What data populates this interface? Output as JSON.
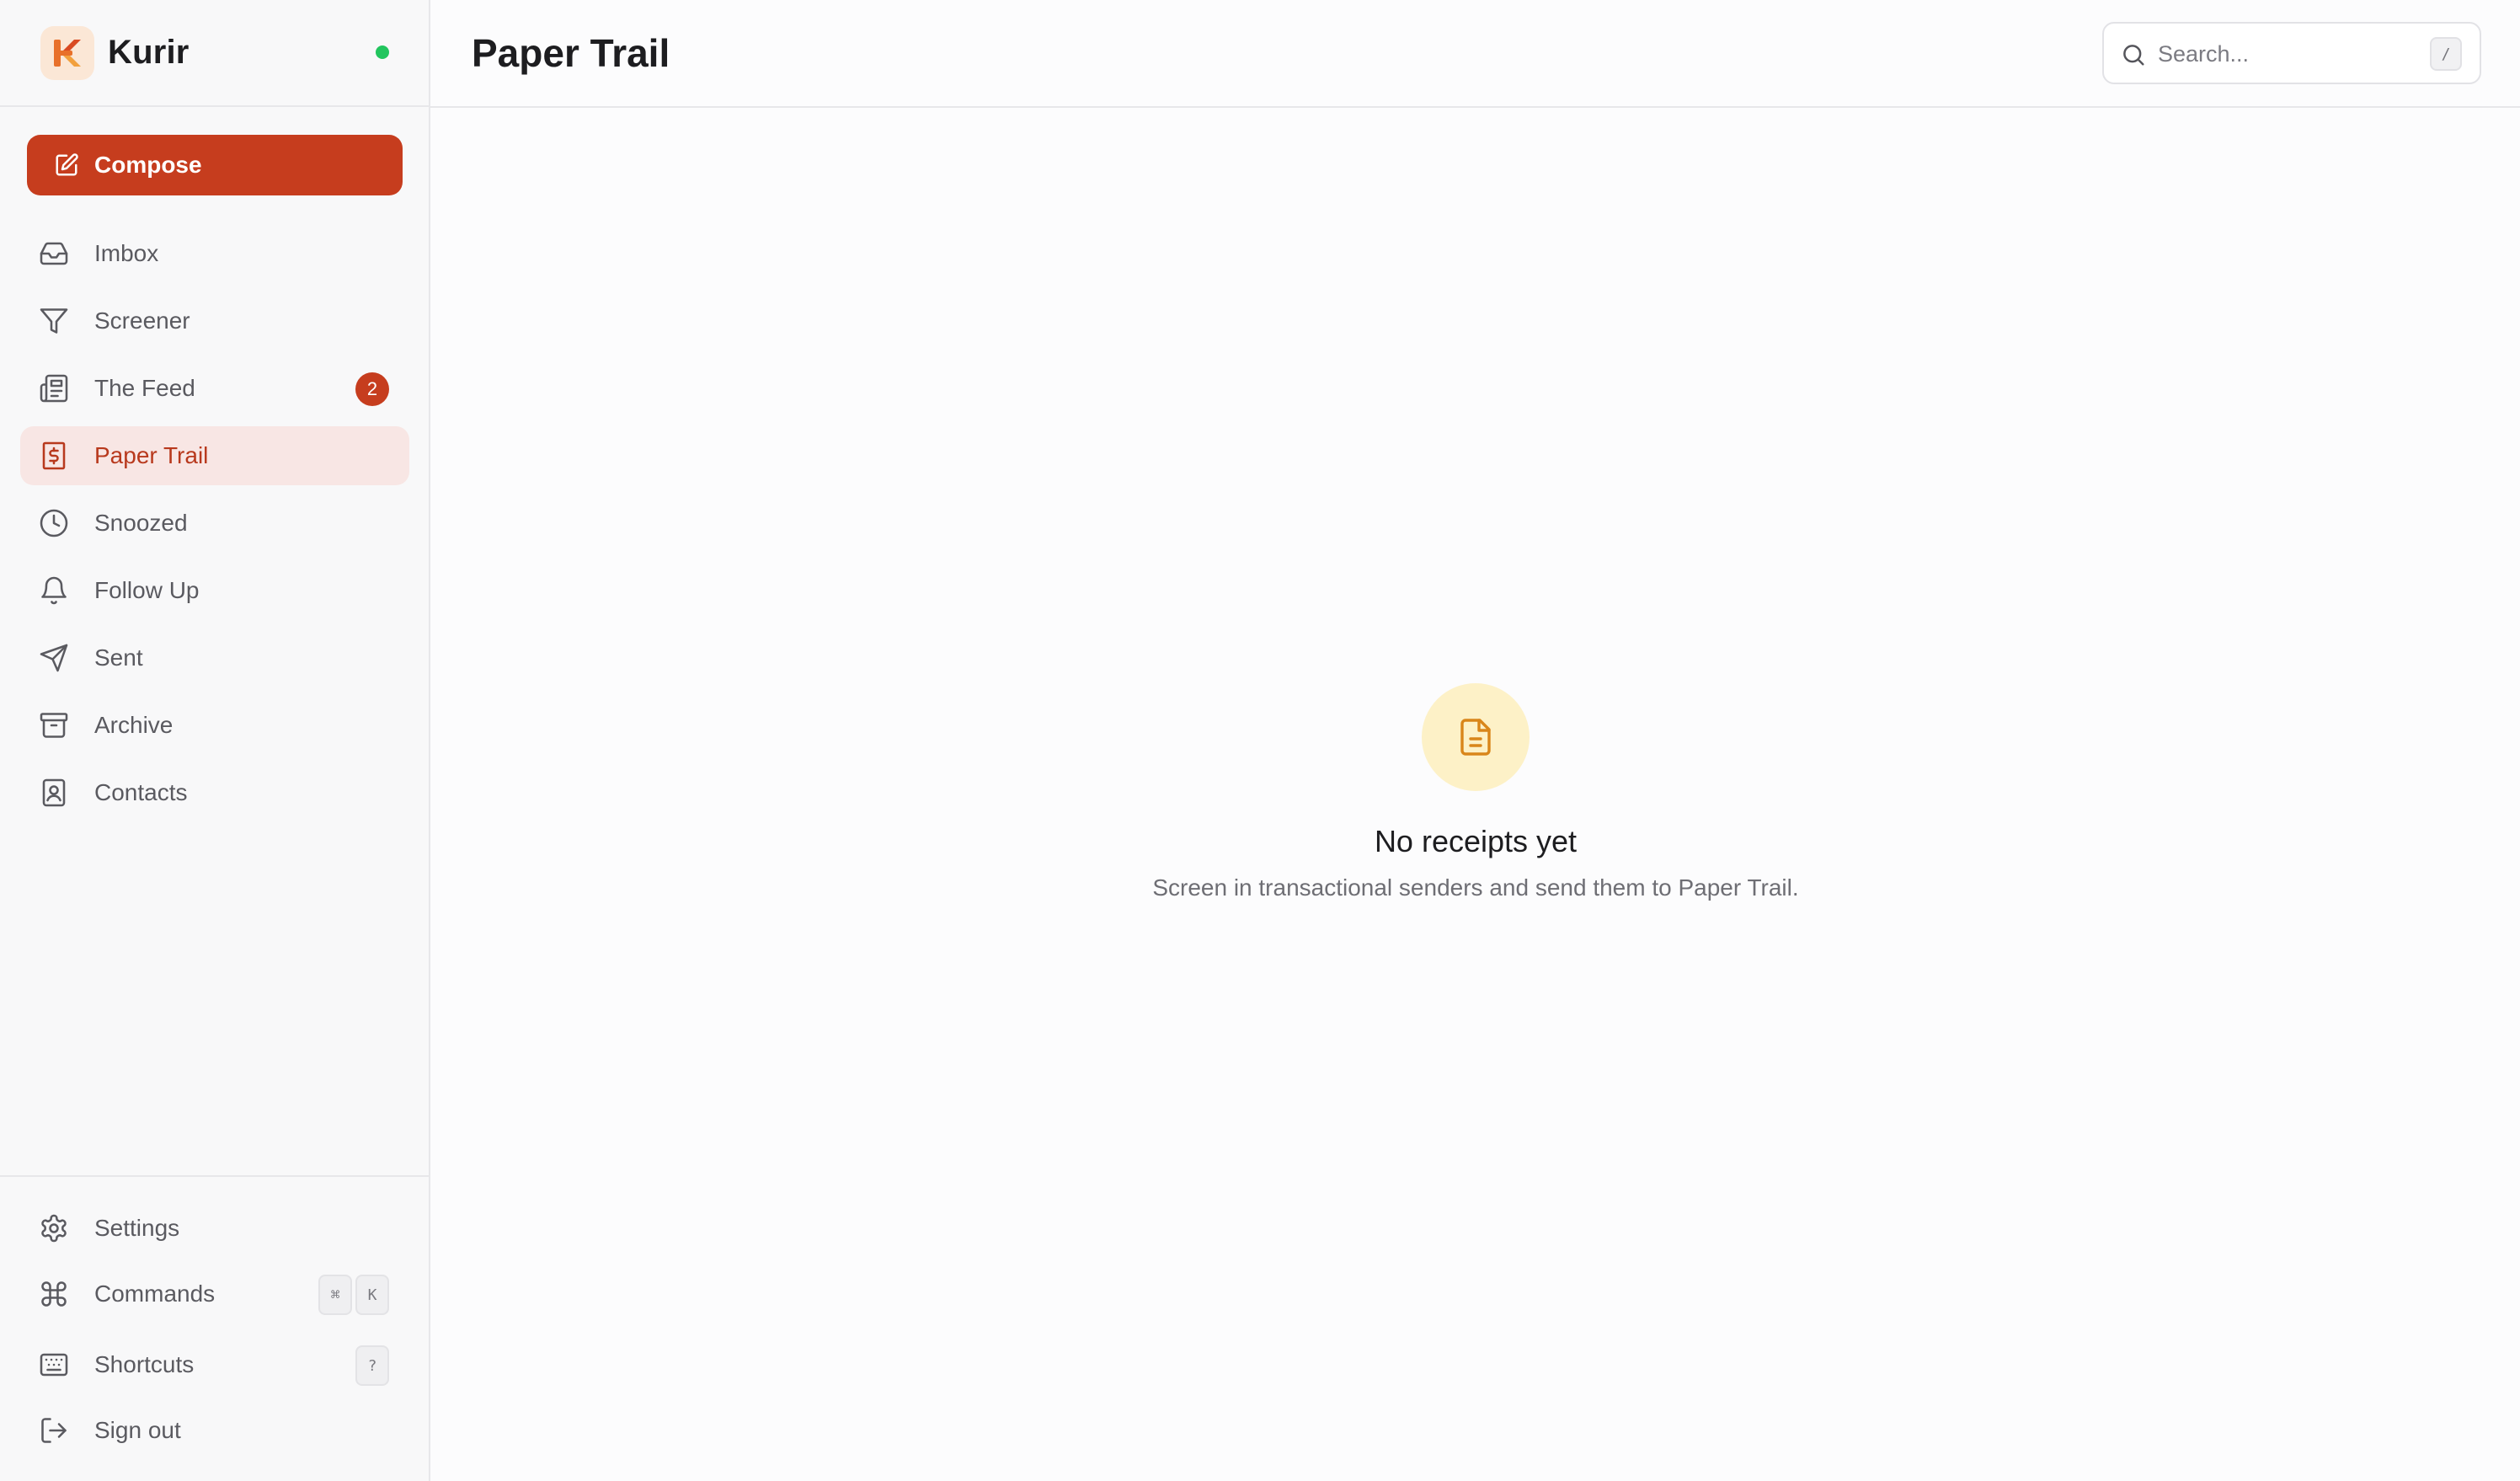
{
  "app": {
    "name": "Kurir",
    "status_color": "#22c55e",
    "accent_color": "#c63d1e"
  },
  "sidebar": {
    "compose_label": "Compose",
    "items": [
      {
        "label": "Imbox",
        "icon": "inbox-icon"
      },
      {
        "label": "Screener",
        "icon": "filter-icon"
      },
      {
        "label": "The Feed",
        "icon": "newspaper-icon",
        "badge": "2"
      },
      {
        "label": "Paper Trail",
        "icon": "receipt-icon",
        "active": true
      },
      {
        "label": "Snoozed",
        "icon": "clock-icon"
      },
      {
        "label": "Follow Up",
        "icon": "bell-icon"
      },
      {
        "label": "Sent",
        "icon": "send-icon"
      },
      {
        "label": "Archive",
        "icon": "archive-icon"
      },
      {
        "label": "Contacts",
        "icon": "contact-book-icon"
      }
    ],
    "footer": [
      {
        "label": "Settings",
        "icon": "gear-icon"
      },
      {
        "label": "Commands",
        "icon": "command-icon",
        "keys": [
          "⌘",
          "K"
        ]
      },
      {
        "label": "Shortcuts",
        "icon": "keyboard-icon",
        "keys": [
          "?"
        ]
      },
      {
        "label": "Sign out",
        "icon": "sign-out-icon"
      }
    ]
  },
  "header": {
    "title": "Paper Trail",
    "search_placeholder": "Search...",
    "search_shortcut": "/"
  },
  "empty_state": {
    "icon": "document-icon",
    "title": "No receipts yet",
    "subtitle": "Screen in transactional senders and send them to Paper Trail."
  }
}
